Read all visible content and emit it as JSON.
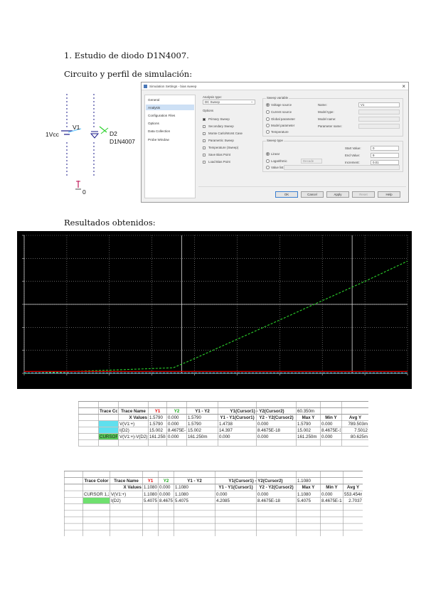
{
  "headings": {
    "section1": "1. Estudio de diodo D1N4007.",
    "circuit_profile": "Circuito y perfil de simulación:",
    "results": "Resultados obtenidos:"
  },
  "circuit": {
    "source_label": "1Vcc",
    "source_name": "V1",
    "diode_ref": "D2",
    "diode_model": "D1N4007",
    "ground_label": "0"
  },
  "dialog": {
    "title": "Simulation Settings - bias sweep",
    "nav_items": [
      "General",
      "Analysis",
      "Configuration Files",
      "Options",
      "Data Collection",
      "Probe Window"
    ],
    "analysis_type_label": "Analysis type:",
    "analysis_type_value": "DC Sweep",
    "options_label": "Options",
    "options": [
      "Primary Sweep",
      "Secondary Sweep",
      "Monte Carlo/Worst Case",
      "Parametric Sweep",
      "Temperature (Sweep)",
      "Save Bias Point",
      "Load Bias Point"
    ],
    "sweep_variable_label": "Sweep variable",
    "sweep_variables": [
      "Voltage source",
      "Current source",
      "Global parameter",
      "Model parameter",
      "Temperature"
    ],
    "name_label": "Name:",
    "name_value": "V1",
    "model_type_label": "Model type:",
    "model_name_label": "Model name:",
    "param_name_label": "Parameter name:",
    "sweep_type_label": "Sweep type",
    "sweep_types": [
      "Linear",
      "Logarithmic",
      "Value list"
    ],
    "log_unit": "Decade",
    "start_label": "Start Value:",
    "start_value": "0",
    "end_label": "End Value:",
    "end_value": "9",
    "increment_label": "Increment:",
    "increment_value": "0.01",
    "buttons": [
      "OK",
      "Cancel",
      "Apply",
      "Reset",
      "Help"
    ]
  },
  "chart_data": {
    "type": "line",
    "title": "",
    "background": "#000000",
    "xlim": [
      0,
      9
    ],
    "ylim": [
      0,
      15
    ],
    "grid": true,
    "series": [
      {
        "color": "#2bd12b",
        "style": "dashed",
        "x": [
          0,
          3.5,
          4,
          5,
          6,
          7,
          8,
          9
        ],
        "y": [
          0,
          0.6,
          1.6,
          3.7,
          5.8,
          7.9,
          10.0,
          12.2
        ]
      },
      {
        "color": "#e00000",
        "style": "solid",
        "x": [
          0,
          9
        ],
        "y": [
          0.2,
          0.2
        ]
      },
      {
        "color": "#4fc3e8",
        "style": "dashed",
        "x": [
          0,
          9
        ],
        "y": [
          0.05,
          0.05
        ]
      }
    ]
  },
  "table1": {
    "headers": [
      "Trace Color",
      "Trace Name",
      "Y1",
      "Y2",
      "Y1 - Y2",
      "Y1(Cursor1) - Y2(Cursor2)",
      "",
      "60.350m"
    ],
    "subheaders": [
      "",
      "X Values",
      "1.5790",
      "0.000",
      "1.5790",
      "Y1 - Y1(Cursor1)",
      "Y2 - Y2(Cursor2)",
      "Max Y",
      "Min Y",
      "Avg Y"
    ],
    "rows": [
      {
        "color": "#5fe0ee",
        "label": "",
        "name": "V(V1:+)",
        "y1": "1.5790",
        "y2": "0.000",
        "diff": "1.5790",
        "c1": "1.4738",
        "c2": "0.000",
        "max": "1.5790",
        "min": "0.000",
        "avg": "789.503m"
      },
      {
        "color": "#5fe0ee",
        "label": "",
        "name": "I(D2)",
        "y1": "15.002",
        "y2": "8.4675E-18",
        "diff": "15.002",
        "c1": "14.397",
        "c2": "8.4675E-18",
        "max": "15.002",
        "min": "8.4675E-18",
        "avg": "7.5012"
      },
      {
        "color": "#58c858",
        "label": "CURSOR 1,2",
        "name": "V(V1:+)-V(D2)",
        "y1": "161.250m",
        "y2": "0.000",
        "diff": "161.250m",
        "c1": "0.000",
        "c2": "0.000",
        "max": "161.250m",
        "min": "0.000",
        "avg": "80.625m"
      }
    ]
  },
  "table2": {
    "headers": [
      "Trace Color",
      "Trace Name",
      "Y1",
      "Y2",
      "Y1 - Y2",
      "Y1(Cursor1) - Y2(Cursor2)",
      "",
      "1.1080"
    ],
    "subheaders": [
      "",
      "X Values",
      "1.1080",
      "0.000",
      "1.1080",
      "Y1 - Y1(Cursor1)",
      "Y2 - Y2(Cursor2)",
      "Max Y",
      "Min Y",
      "Avg Y"
    ],
    "rows": [
      {
        "color": "",
        "label": "CURSOR 1,2",
        "name": "V(V1:+)",
        "y1": "1.1080",
        "y2": "0.000",
        "diff": "1.1080",
        "c1": "0.000",
        "c2": "0.000",
        "max": "1.1080",
        "min": "0.000",
        "avg": "553.454m"
      },
      {
        "color": "#6fe06f",
        "label": "",
        "name": "I(D2)",
        "y1": "5.4075",
        "y2": "8.4675E-18",
        "diff": "5.4075",
        "c1": "4.2085",
        "c2": "8.4675E-18",
        "max": "5.4075",
        "min": "8.4675E-18",
        "avg": "2.7037"
      }
    ]
  }
}
